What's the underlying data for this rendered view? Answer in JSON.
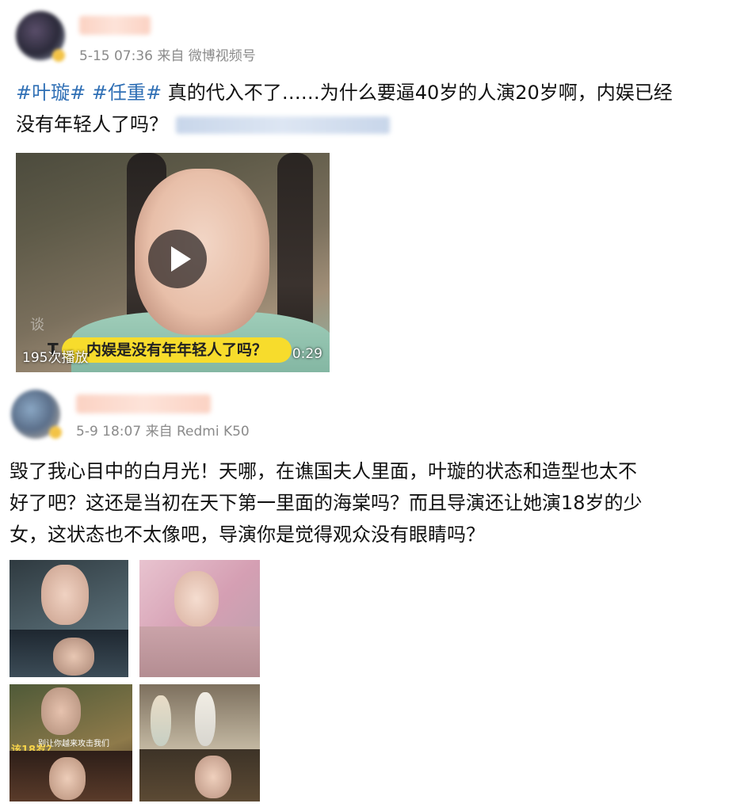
{
  "posts": [
    {
      "meta": "5-15 07:36 来自 微博视频号",
      "text": {
        "hashtag1": "#叶璇#",
        "hashtag2": "#任重#",
        "line1": "真的代入不了……为什么要逼40岁的人演20岁啊，内娱已经",
        "line2": "没有年轻人了吗？"
      },
      "video": {
        "caption": "内娱是没有年年轻人了吗？",
        "caption_icon": "T",
        "play_count": "195次播放",
        "duration": "0:29",
        "watermark": "谈"
      }
    },
    {
      "meta": "5-9 18:07 来自 Redmi K50",
      "text": {
        "line1": "毁了我心目中的白月光！天哪，在谯国夫人里面，叶璇的状态和造型也太不",
        "line2": "好了吧？这还是当初在天下第一里面的海棠吗？而且导演还让她演18岁的少",
        "line3": "女，这状态也不太像吧，导演你是觉得观众没有眼睛吗？"
      },
      "images": {
        "img3_caption": "别让你越来攻击我们",
        "img3_badge": "该18岁？"
      }
    }
  ],
  "colors": {
    "hashtag": "#2f6fb5",
    "meta": "#8a8a8a",
    "caption_bg": "#f7dc2c"
  }
}
